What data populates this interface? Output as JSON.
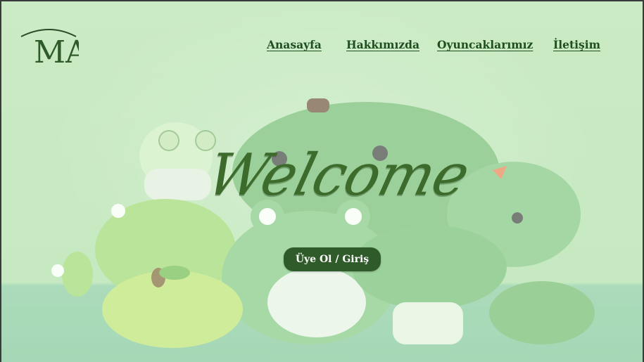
{
  "brand": {
    "logo_text": "MA"
  },
  "nav": {
    "items": [
      {
        "label": "Anasayfa"
      },
      {
        "label": "Hakkımızda"
      },
      {
        "label": "Oyuncaklarımız"
      },
      {
        "label": "İletişim"
      }
    ]
  },
  "hero": {
    "title": "Welcome",
    "cta_label": "Üye Ol / Giriş"
  },
  "colors": {
    "background": "#c2e6bb",
    "accent": "#2f5a29",
    "nav_text": "#1f4f1f",
    "title": "#3c6b2c"
  }
}
